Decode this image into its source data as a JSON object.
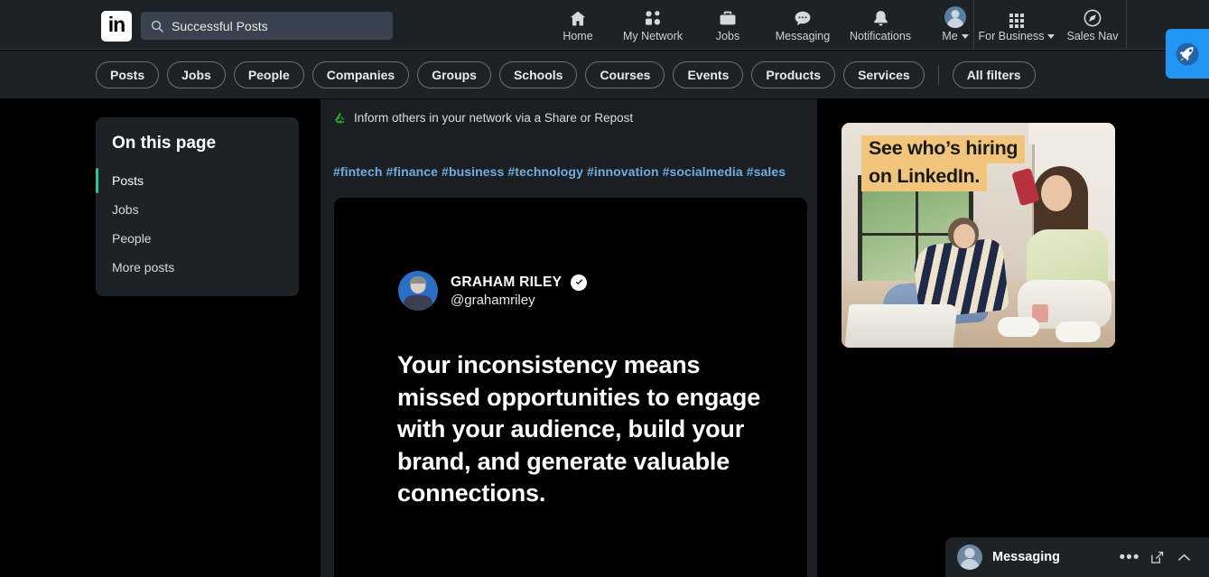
{
  "header": {
    "logo_text": "in",
    "logo_name": "linkedin-logo",
    "search": {
      "value": "Successful Posts",
      "placeholder": "Search"
    },
    "nav": [
      {
        "label": "Home",
        "icon": "home-icon"
      },
      {
        "label": "My Network",
        "icon": "network-icon"
      },
      {
        "label": "Jobs",
        "icon": "briefcase-icon"
      },
      {
        "label": "Messaging",
        "icon": "message-bubble-icon"
      },
      {
        "label": "Notifications",
        "icon": "bell-icon"
      },
      {
        "label": "Me",
        "icon": "avatar-icon",
        "caret": true
      }
    ],
    "business": {
      "label": "For Business",
      "icon": "grid-icon",
      "caret": true
    },
    "sales_nav": {
      "label": "Sales Nav",
      "icon": "compass-icon"
    },
    "rocket_button": {
      "icon": "rocket-icon"
    }
  },
  "filters": {
    "pills": [
      "Posts",
      "Jobs",
      "People",
      "Companies",
      "Groups",
      "Schools",
      "Courses",
      "Events",
      "Products",
      "Services"
    ],
    "all_filters": "All filters"
  },
  "sidebar": {
    "title": "On this page",
    "items": [
      {
        "label": "Posts",
        "active": true
      },
      {
        "label": "Jobs",
        "active": false
      },
      {
        "label": "People",
        "active": false
      },
      {
        "label": "More posts",
        "active": false
      }
    ]
  },
  "main": {
    "repost": {
      "icon": "repost-recycle-icon",
      "text": "Inform others in your network via a Share or Repost"
    },
    "hashtags": "#fintech #finance #business #technology #innovation #socialmedia #sales",
    "post": {
      "author_name": "GRAHAM RILEY",
      "author_handle": "@grahamriley",
      "verified_icon": "verified-check-icon",
      "body": "Your inconsistency means missed opportunities to engage with your audience, build your brand, and generate valuable connections."
    }
  },
  "ad": {
    "line1": "See who’s hiring",
    "line2": "on LinkedIn.",
    "highlight_color": "#f2c57c"
  },
  "messaging": {
    "title": "Messaging",
    "more_icon": "ellipsis-icon",
    "compose_icon": "compose-pencil-icon",
    "expand_icon": "chevron-up-icon"
  },
  "colors": {
    "page_background": "#000000",
    "panel_background": "#1d2226",
    "main_column_background": "#1b1f23",
    "accent_green": "#36c18c",
    "link_blue": "#70aee0",
    "rocket_blue": "#2196f3"
  }
}
